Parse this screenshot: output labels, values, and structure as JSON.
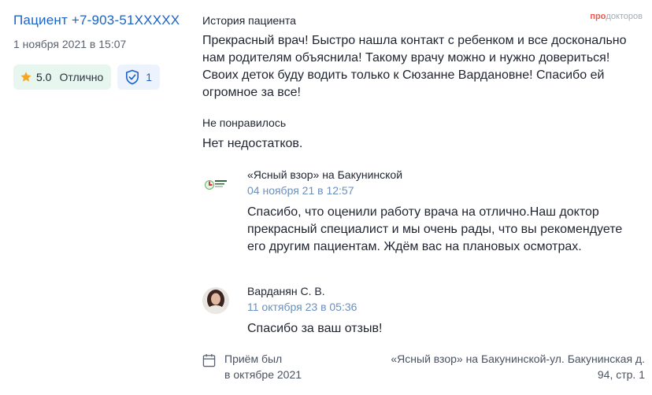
{
  "logo": {
    "pro": "про",
    "rest": "докторов"
  },
  "patient": {
    "name": "Пациент +7-903-51XXXXX",
    "date": "1 ноября 2021 в 15:07"
  },
  "rating": {
    "score": "5.0",
    "label": "Отлично",
    "star_color": "#f6a623"
  },
  "verified": {
    "count": "1"
  },
  "review": {
    "story_title": "История пациента",
    "story_text": "Прекрасный врач! Быстро нашла контакт с ребенком и все досконально нам родителям объяснила! Такому врачу можно и нужно довериться! Своих деток буду водить только к Сюзанне Вардановне! Спасибо ей огромное за все!",
    "dislike_title": "Не понравилось",
    "dislike_text": "Нет недостатков."
  },
  "replies": [
    {
      "author": "«Ясный взор» на Бакунинской",
      "date": "04 ноября 21 в 12:57",
      "text": "Спасибо, что оценили работу врача на отлично.Наш доктор прекрасный специалист и мы очень рады, что вы рекомендуете его другим пациентам. Ждём вас на плановых осмотрах."
    },
    {
      "author": "Варданян С. В.",
      "date": "11 октября 23 в 05:36",
      "text": "Спасибо за ваш отзыв!"
    }
  ],
  "visit": {
    "line1": "Приём был",
    "line2": "в октябре 2021"
  },
  "clinic_address": "«Ясный взор» на Бакунинской-ул. Бакунинская д. 94, стр. 1",
  "colors": {
    "accent": "#1b63c6",
    "rating_bg": "#e7f6ee",
    "verify_bg": "#edf3fc",
    "reply_date": "#6b90bb"
  }
}
